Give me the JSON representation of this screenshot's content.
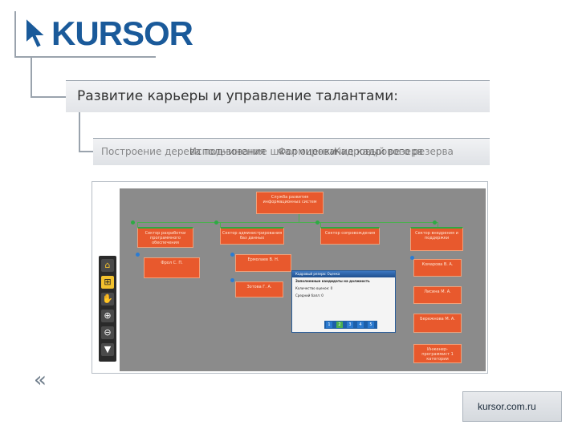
{
  "brand": {
    "logo_text": "KURSOR",
    "logo_color": "#1a5a9a",
    "logo_icon": "cursor-arrow-icon"
  },
  "slide": {
    "title": "Развитие карьеры и управление талантами:",
    "subtitle_layers": [
      "Построение дерева подчинения",
      "Использование шкал оценки",
      "Кадровый резерв",
      "Формирование кадрового резерва"
    ]
  },
  "screenshot": {
    "toolbar_icons": [
      "home-icon",
      "tree-icon",
      "hand-icon",
      "zoom-in-icon",
      "zoom-out-icon",
      "filter-icon"
    ],
    "org_boxes": [
      "Служба развития информационных систем",
      "Сектор разработки программного обеспечения",
      "Сектор администрирования баз данных",
      "Сектор сопровождения",
      "Сектор внедрения и поддержки",
      "Фрол С. П.",
      "Ведущий инженер-программист",
      "Ермолаев В. Н.",
      "Инженер 1 категории",
      "Зотова Г. А.",
      "Ведущий инженер",
      "Шилов Н. А.",
      "Начальник отдела",
      "Комарова В. А.",
      "Ведущий инженер-программист",
      "Лисина М. А.",
      "Инженер 2 категории",
      "Бережнова М. А.",
      "Начальник сектора",
      "Инженер-программист 1 категории"
    ],
    "popup": {
      "header": "Кадровый резерв: Оценка",
      "rows": [
        "Заполненные кандидаты на должность",
        "Количество оценок: 0",
        "Средний балл: 0"
      ],
      "pages": [
        "1",
        "2",
        "3",
        "4",
        "5"
      ]
    }
  },
  "footer": {
    "back_glyph": "«",
    "url": "kursor.com.ru"
  },
  "colors": {
    "box_red": "#e8592d",
    "box_orange": "#f29a2e",
    "connector": "#9aa3ad",
    "canvas_bg": "#8b8b8b"
  }
}
